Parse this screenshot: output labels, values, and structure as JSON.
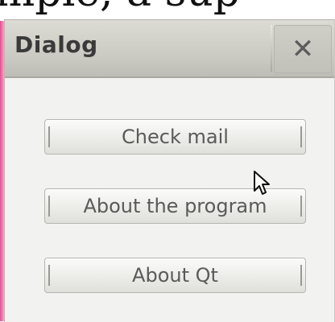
{
  "top_caption": "mpie, a sup",
  "dialog": {
    "title": "Dialog",
    "close_icon": "close-icon",
    "buttons": [
      {
        "label": "Check mail"
      },
      {
        "label": "About the program"
      },
      {
        "label": "About Qt"
      }
    ]
  },
  "cursor_icon": "mouse-pointer-icon"
}
